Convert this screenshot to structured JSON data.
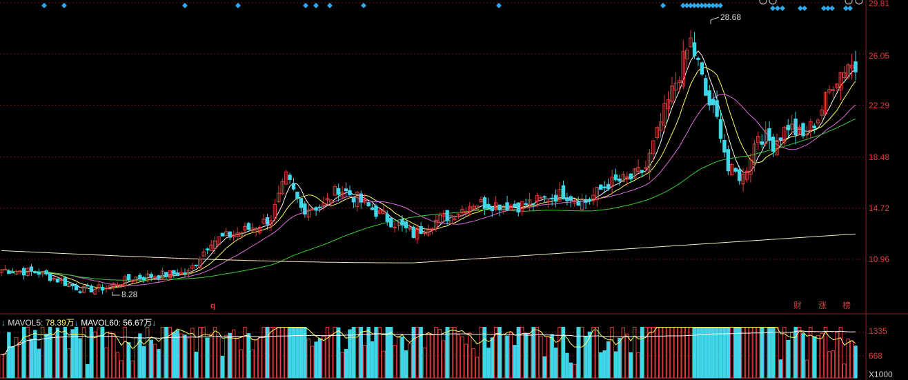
{
  "chart_data": {
    "type": "candlestick",
    "price_axis": {
      "ticks": [
        "29.81",
        "26.05",
        "22.29",
        "18.48",
        "14.72",
        "10.96"
      ],
      "ylim": [
        7.2,
        29.81
      ]
    },
    "annotations": {
      "high_label": "28.68",
      "low_label": "8.28",
      "marker_q": "q"
    },
    "badges": [
      "财",
      "涨",
      "榜"
    ],
    "volume_panel": {
      "legend": [
        {
          "name": "MAVOL5",
          "value": "78.39万"
        },
        {
          "name": "MAVOL60",
          "value": "56.67万"
        }
      ],
      "ticks": [
        "1335",
        "668",
        "X1000"
      ]
    },
    "colors": {
      "up": "#e03c3c",
      "down": "#3fd6e8",
      "ma5": "#ffffff",
      "ma10": "#ffff66",
      "ma20": "#e070e0",
      "ma60": "#38d038",
      "ma250": "#f0f0c0",
      "grid": "#7a1010",
      "axis_text": "#e03c3c"
    }
  }
}
